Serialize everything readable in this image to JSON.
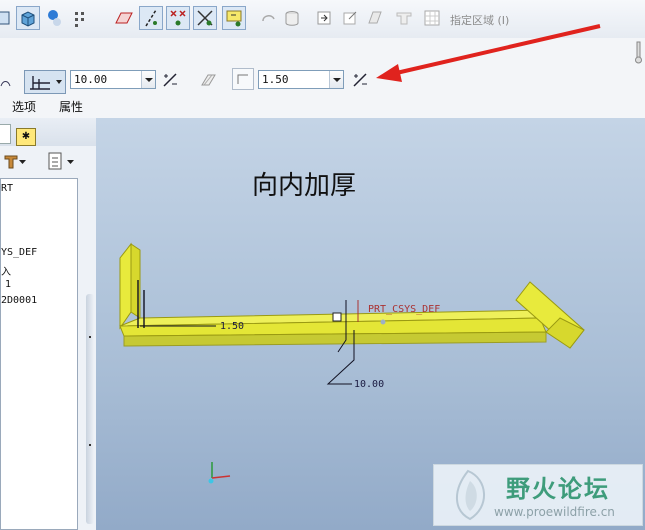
{
  "toolbar": {
    "region_label": "指定区域 (I)"
  },
  "dashboard": {
    "thickness_value": "10.00",
    "offset_value": "1.50",
    "tabs": [
      "选项",
      "属性"
    ]
  },
  "tree": {
    "items": [
      "RT",
      "YS_DEF",
      "入",
      "1",
      "2D0001"
    ]
  },
  "graphics": {
    "annotation": "向内加厚",
    "dim_offset": "1.50",
    "dim_thickness": "10.00",
    "csys_label": "PRT_CSYS_DEF"
  },
  "watermark": {
    "title": "野火论坛",
    "url": "www.proewildfire.cn"
  },
  "colors": {
    "highlight_yellow": "#e8ea3c",
    "arrow_red": "#e0231e"
  }
}
